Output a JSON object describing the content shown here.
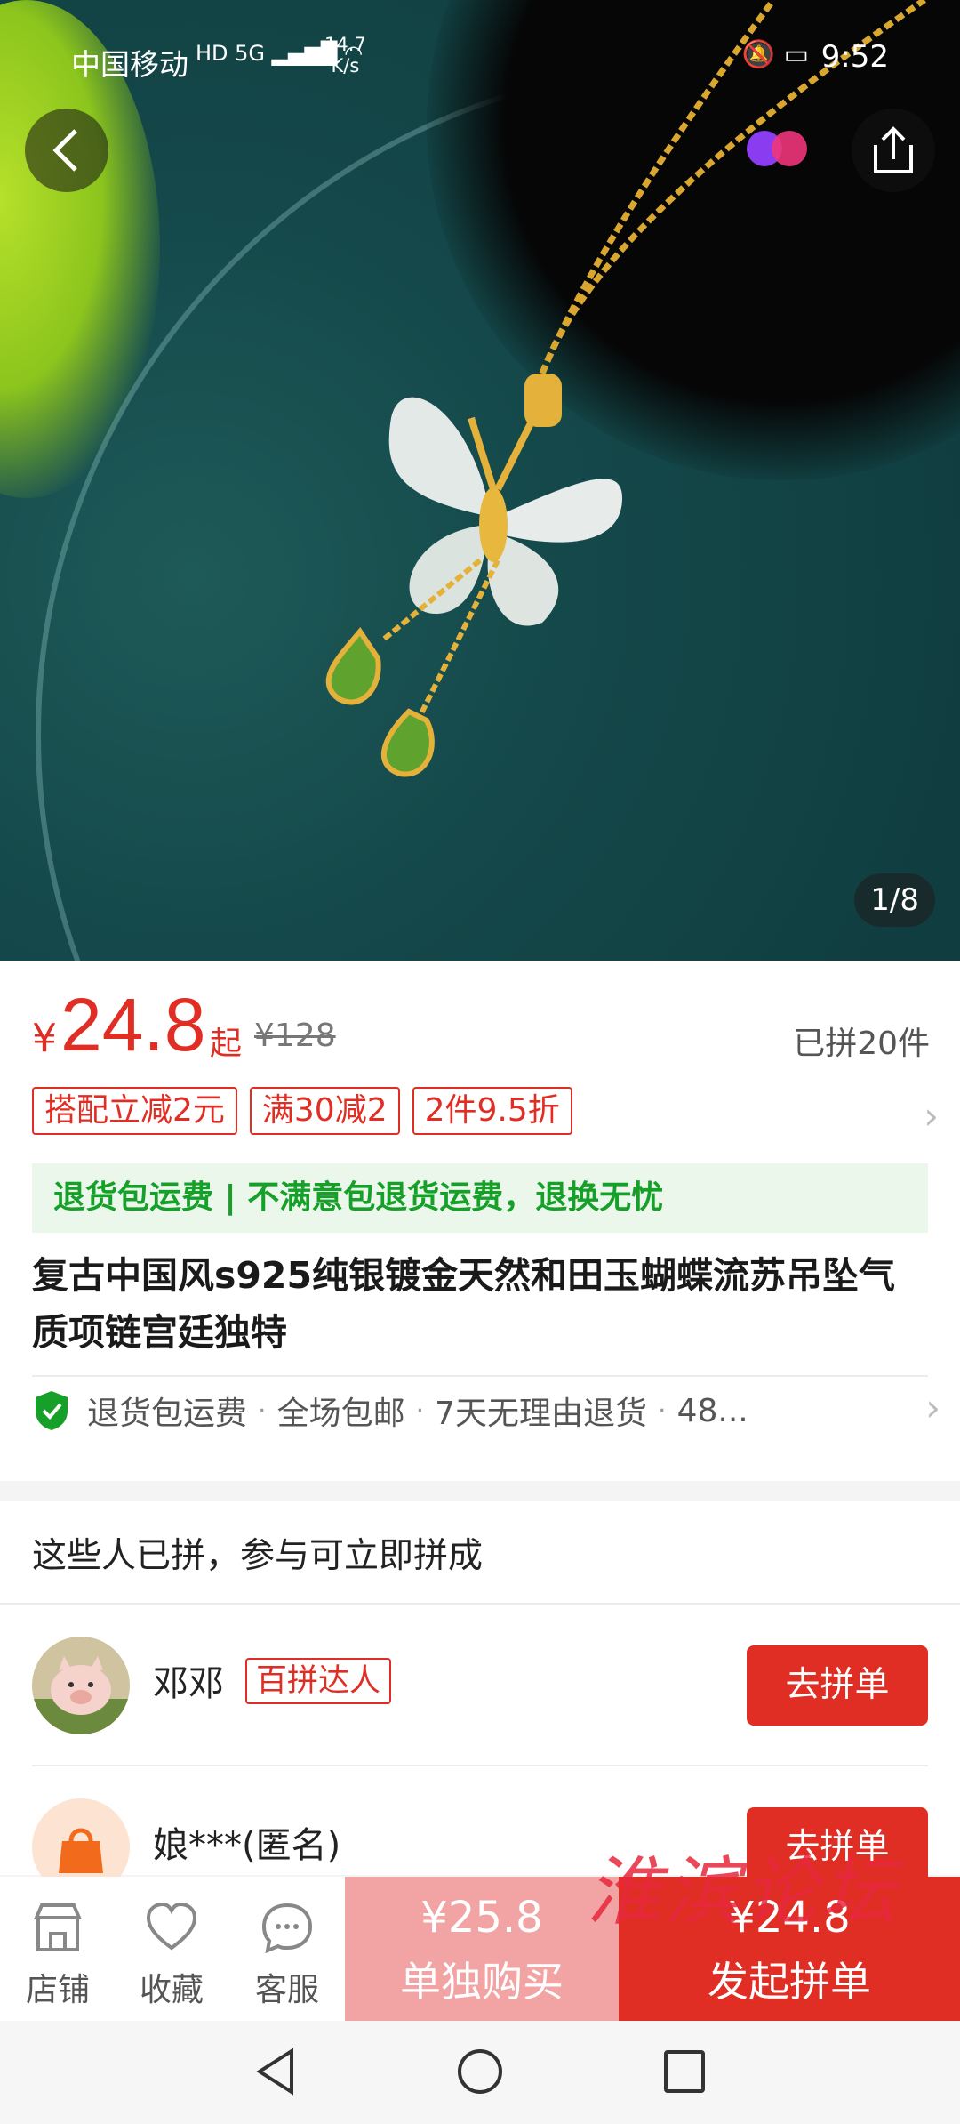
{
  "status_bar": {
    "carrier": "中国移动",
    "network": "HD 5G",
    "speed_value": "14.7",
    "speed_unit": "K/s",
    "time": "9:52"
  },
  "hero": {
    "page_indicator": "1/8"
  },
  "price": {
    "currency": "¥",
    "value": "24.8",
    "suffix": "起",
    "original": "¥128",
    "sold": "已拼20件"
  },
  "promotions": [
    "搭配立减2元",
    "满30减2",
    "2件9.5折"
  ],
  "guarantee_banner": "退货包运费 | 不满意包退货运费，退换无忧",
  "title": "复古中国风s925纯银镀金天然和田玉蝴蝶流苏吊坠气质项链宫廷独特",
  "services": [
    "退货包运费",
    "全场包邮",
    "7天无理由退货",
    "48..."
  ],
  "group": {
    "heading": "这些人已拼，参与可立即拼成",
    "members": [
      {
        "name": "邓邓",
        "badge": "百拼达人",
        "button": "去拼单"
      },
      {
        "name": "娘***(匿名)",
        "badge": "",
        "button": "去拼单"
      }
    ]
  },
  "action_bar": {
    "store": "店铺",
    "favorite": "收藏",
    "service": "客服",
    "single_price": "¥25.8",
    "single_label": "单独购买",
    "group_price": "¥24.8",
    "group_label": "发起拼单"
  },
  "watermark": "淮滨论坛",
  "colors": {
    "accent": "#e02e24",
    "green": "#16a02a"
  }
}
